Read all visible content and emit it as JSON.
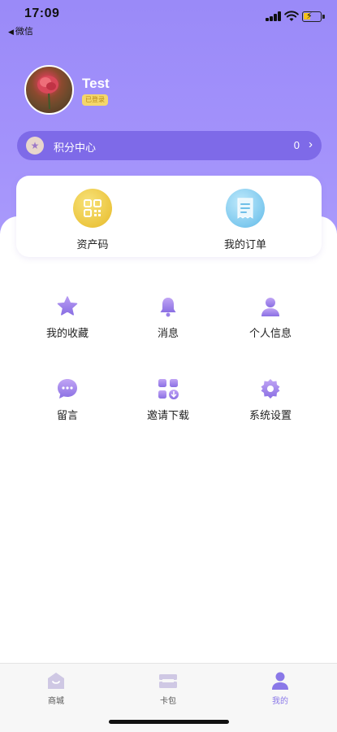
{
  "status_bar": {
    "time": "17:09",
    "back_label": "微信",
    "back_arrow": "◀"
  },
  "profile": {
    "name": "Test",
    "badge": "已登录"
  },
  "points": {
    "label": "积分中心",
    "value": "0",
    "chevron": "›",
    "icon": "star-icon"
  },
  "card": {
    "items": [
      {
        "label": "资产码",
        "icon": "qr-code-icon"
      },
      {
        "label": "我的订单",
        "icon": "receipt-icon"
      }
    ]
  },
  "grid": {
    "items": [
      {
        "label": "我的收藏",
        "icon": "star-icon"
      },
      {
        "label": "消息",
        "icon": "bell-icon"
      },
      {
        "label": "个人信息",
        "icon": "person-icon"
      },
      {
        "label": "留言",
        "icon": "chat-bubble-icon"
      },
      {
        "label": "邀请下载",
        "icon": "download-grid-icon"
      },
      {
        "label": "系统设置",
        "icon": "gear-icon"
      }
    ]
  },
  "tabs": [
    {
      "label": "商城",
      "icon": "shop-icon",
      "active": false
    },
    {
      "label": "卡包",
      "icon": "card-wallet-icon",
      "active": false
    },
    {
      "label": "我的",
      "icon": "person-icon",
      "active": true
    }
  ],
  "colors": {
    "accent": "#9a8af8",
    "points_bar": "#7e6ae8",
    "active_tab": "#8a78e8",
    "badge": "#f4d76a"
  }
}
